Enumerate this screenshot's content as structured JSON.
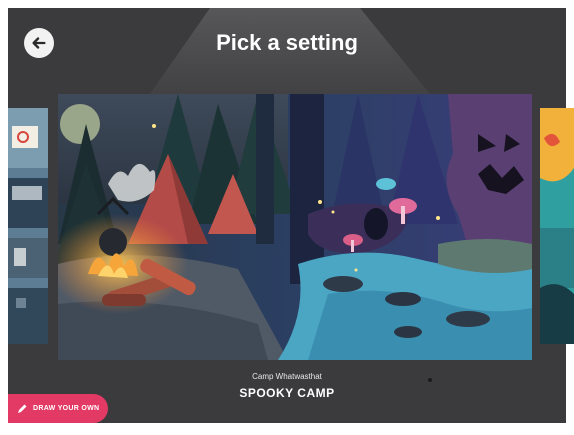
{
  "header": {
    "title": "Pick a setting",
    "back_icon": "back-arrow-icon"
  },
  "carousel": {
    "selected": {
      "subtitle": "Camp Whatwasthat",
      "name": "SPOOKY CAMP"
    }
  },
  "draw_button": {
    "label": "DRAW YOUR OWN",
    "icon": "pencil-icon",
    "color": "#e23a64"
  },
  "colors": {
    "background": "#3b3b3d",
    "accent": "#e23a64"
  }
}
